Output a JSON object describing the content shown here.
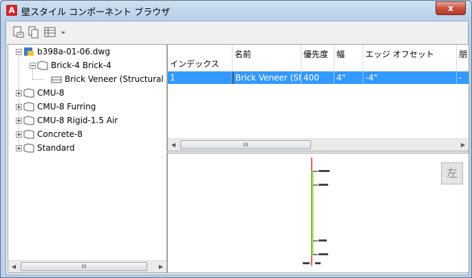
{
  "window": {
    "title": "壁スタイル コンポーネント ブラウザ",
    "close_glyph": "x"
  },
  "toolbar": {
    "buttons": [
      {
        "icon": "open-drawing-icon"
      },
      {
        "icon": "copy-icon"
      },
      {
        "icon": "table-view-icon"
      },
      {
        "icon": "dropdown-arrow-icon"
      }
    ]
  },
  "tree": {
    "root": {
      "label": "b398a-01-06.dwg",
      "icon": "drawing-file-icon"
    },
    "nodes": [
      {
        "label": "Brick-4 Brick-4",
        "expanded": true
      },
      {
        "label": "Brick Veneer (Structural",
        "leaf": true
      },
      {
        "label": "CMU-8",
        "expanded": false
      },
      {
        "label": "CMU-8 Furring",
        "expanded": false
      },
      {
        "label": "CMU-8 Rigid-1.5 Air",
        "expanded": false
      },
      {
        "label": "Concrete-8",
        "expanded": false
      },
      {
        "label": "Standard",
        "expanded": false
      }
    ],
    "scroll_thumb": "III"
  },
  "grid": {
    "columns": [
      "インデックス",
      "名前",
      "優先度",
      "幅",
      "エッジ オフセット",
      "朋"
    ],
    "rows": [
      {
        "index": "1",
        "name": "Brick Veneer (Str...",
        "priority": "400",
        "width": "4\"",
        "edge_offset": "-4\"",
        "extra": "-"
      }
    ],
    "scroll_thumb": "III"
  },
  "preview": {
    "view_label": "左"
  },
  "colors": {
    "selection": "#3399ff",
    "tree_bg": "#ffffff",
    "accent_red": "#d2222a",
    "wall_green": "#80c020"
  }
}
